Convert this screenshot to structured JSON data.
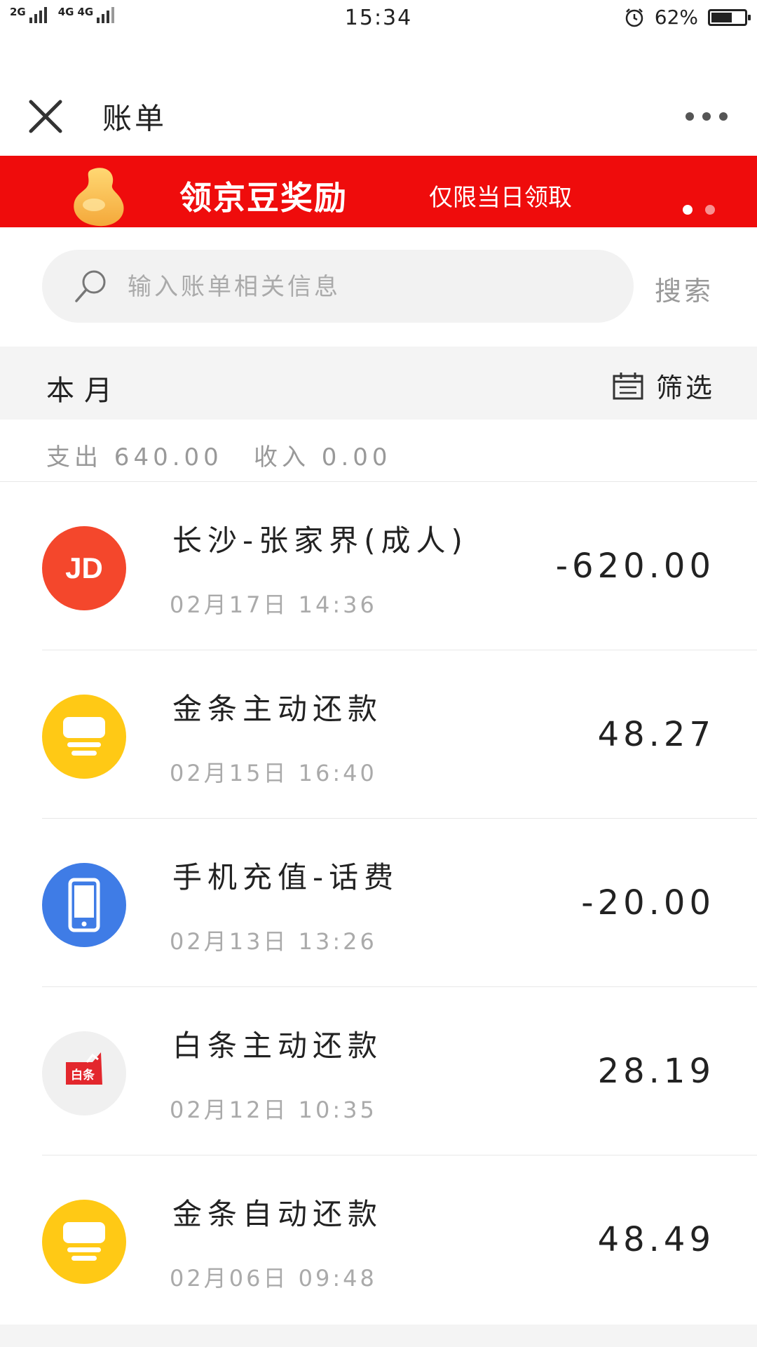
{
  "status_bar": {
    "signal_1": "2G",
    "signal_2": "4G",
    "signal_3": "4G",
    "time": "15:34",
    "battery_text": "62%",
    "battery_level": 0.62
  },
  "nav": {
    "title": "账单"
  },
  "banner": {
    "title": "领京豆奖励",
    "subtitle": "仅限当日领取",
    "dot_count": 2,
    "active_dot": 0,
    "bg_color": "#ef0c0c"
  },
  "search": {
    "placeholder": "输入账单相关信息",
    "button_label": "搜索"
  },
  "month_bar": {
    "label": "本月",
    "filter_label": "筛选"
  },
  "summary": {
    "expense": "支出 640.00",
    "income": "收入 0.00"
  },
  "transactions": [
    {
      "icon": "jd-icon",
      "icon_text": "JD",
      "title": "长沙-张家界(成人)",
      "date": "02月17日 14:36",
      "amount": "-620.00"
    },
    {
      "icon": "jintiao-icon",
      "title": "金条主动还款",
      "date": "02月15日 16:40",
      "amount": "48.27"
    },
    {
      "icon": "phone-icon",
      "title": "手机充值-话费",
      "date": "02月13日 13:26",
      "amount": "-20.00"
    },
    {
      "icon": "baitiao-icon",
      "icon_text": "白条",
      "title": "白条主动还款",
      "date": "02月12日 10:35",
      "amount": "28.19"
    },
    {
      "icon": "jintiao-icon",
      "title": "金条自动还款",
      "date": "02月06日 09:48",
      "amount": "48.49"
    }
  ]
}
